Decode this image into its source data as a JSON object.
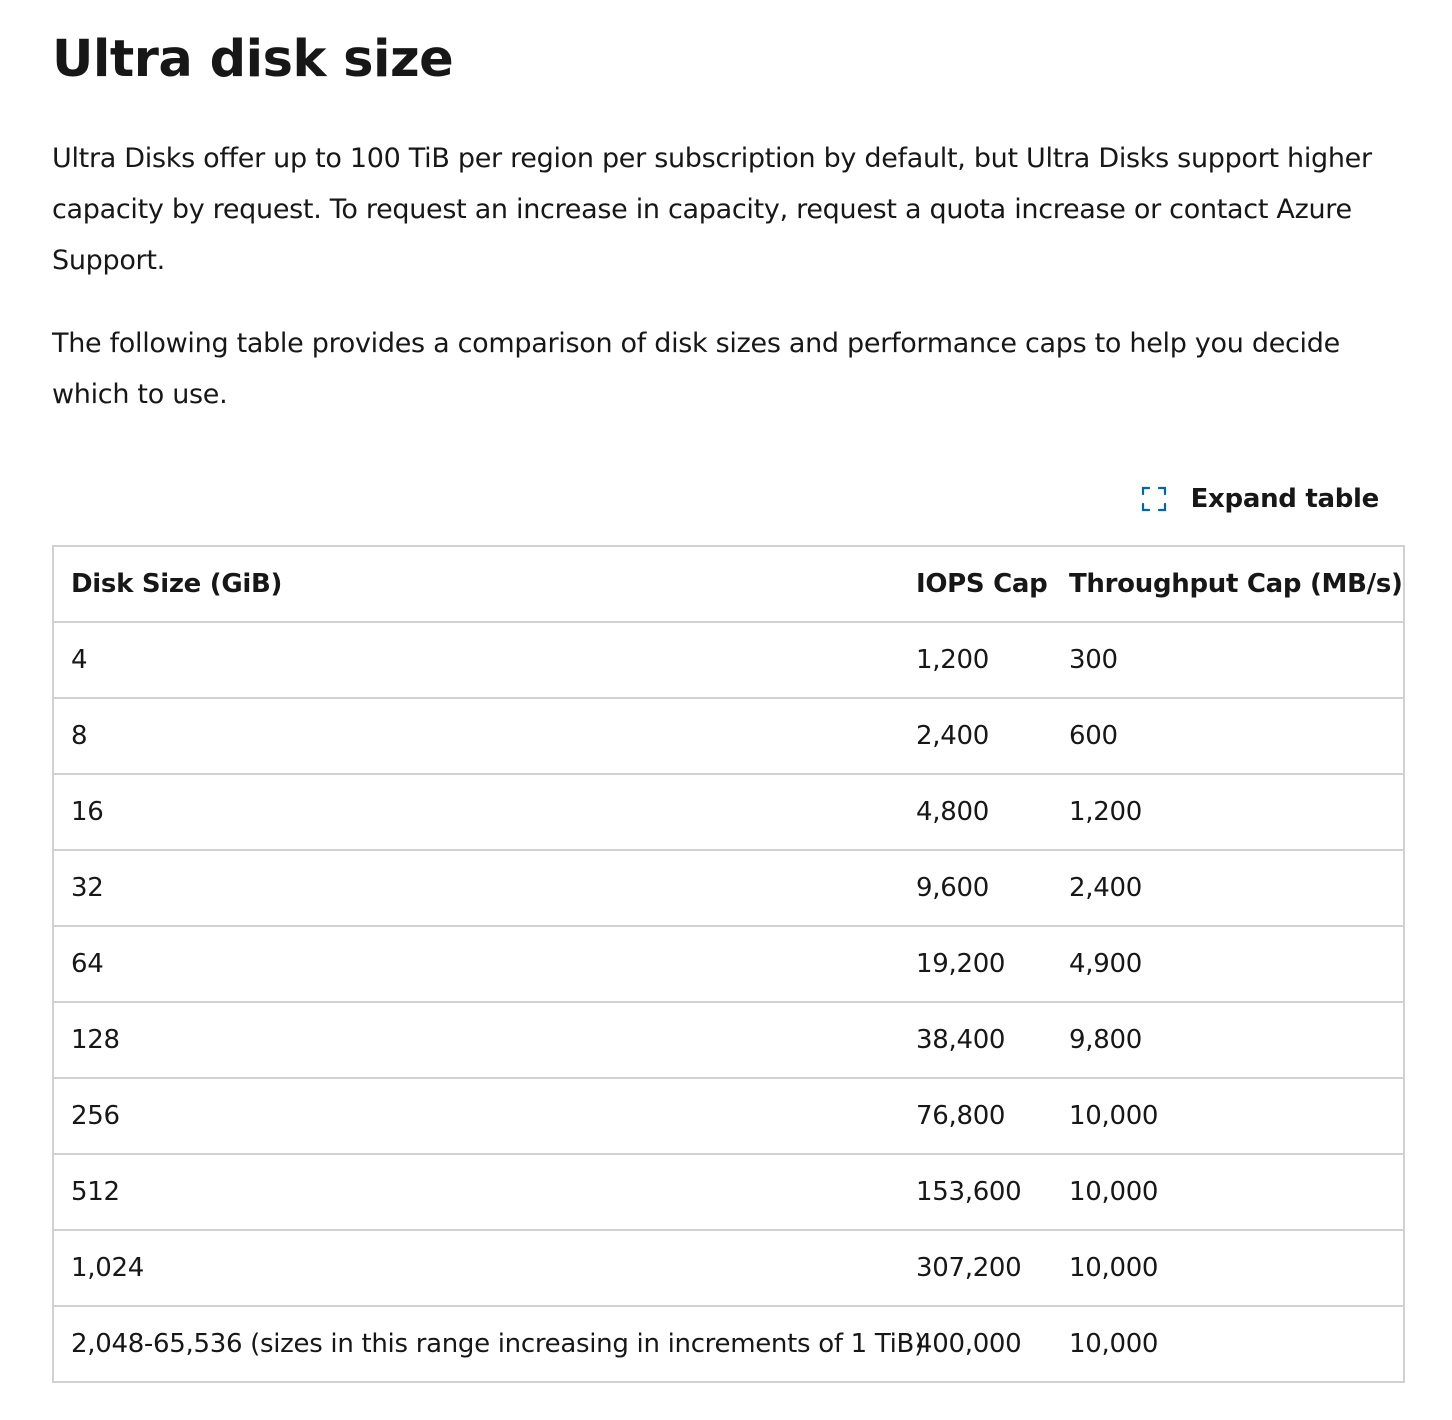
{
  "page": {
    "title": "Ultra disk size",
    "paragraphs": [
      "Ultra Disks offer up to 100 TiB per region per subscription by default, but Ultra Disks support higher capacity by request. To request an increase in capacity, request a quota increase or contact Azure Support.",
      "The following table provides a comparison of disk sizes and performance caps to help you decide which to use."
    ]
  },
  "expand": {
    "label": "Expand table",
    "icon": "expand-icon",
    "icon_color": "#0065b3"
  },
  "table": {
    "headers": [
      "Disk Size (GiB)",
      "IOPS Cap",
      "Throughput Cap (MB/s)"
    ],
    "rows": [
      [
        "4",
        "1,200",
        "300"
      ],
      [
        "8",
        "2,400",
        "600"
      ],
      [
        "16",
        "4,800",
        "1,200"
      ],
      [
        "32",
        "9,600",
        "2,400"
      ],
      [
        "64",
        "19,200",
        "4,900"
      ],
      [
        "128",
        "38,400",
        "9,800"
      ],
      [
        "256",
        "76,800",
        "10,000"
      ],
      [
        "512",
        "153,600",
        "10,000"
      ],
      [
        "1,024",
        "307,200",
        "10,000"
      ],
      [
        "2,048-65,536 (sizes in this range increasing in increments of 1 TiB)",
        "400,000",
        "10,000"
      ]
    ]
  }
}
